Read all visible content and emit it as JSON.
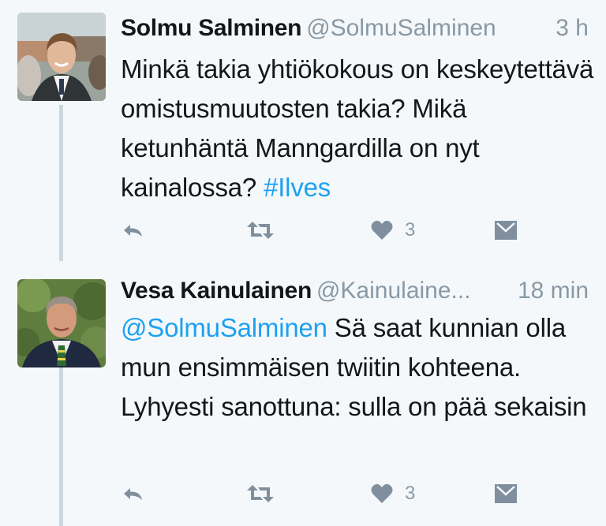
{
  "tweets": [
    {
      "name": "Solmu Salminen",
      "handle": "@SolmuSalminen",
      "time": "3 h",
      "text_parts": {
        "plain": "Minkä takia yhtiökokous on keskeytettävä omistusmuutosten takia? Mikä ketunhäntä Manngardilla on nyt kainalossa? ",
        "hashtag": "#Ilves"
      },
      "like_count": "3",
      "actions": [
        "reply-icon",
        "retweet-icon",
        "heart-icon",
        "envelope-icon"
      ]
    },
    {
      "name": "Vesa Kainulainen",
      "handle": "@Kainulaine...",
      "time": "18 min",
      "text_parts": {
        "mention": "@SolmuSalminen",
        "plain": " Sä saat kunnian olla mun ensimmäisen twiitin kohteena. Lyhyesti sanottuna: sulla on pää sekaisin"
      },
      "like_count": "3",
      "actions": [
        "reply-icon",
        "retweet-icon",
        "heart-icon",
        "envelope-icon"
      ]
    }
  ],
  "colors": {
    "background": "#f5f8fa",
    "text": "#14171a",
    "muted": "#8899a6",
    "link": "#1da1f2",
    "action_icon": "#7f8f9d",
    "thread_line": "#ccd6dd"
  }
}
